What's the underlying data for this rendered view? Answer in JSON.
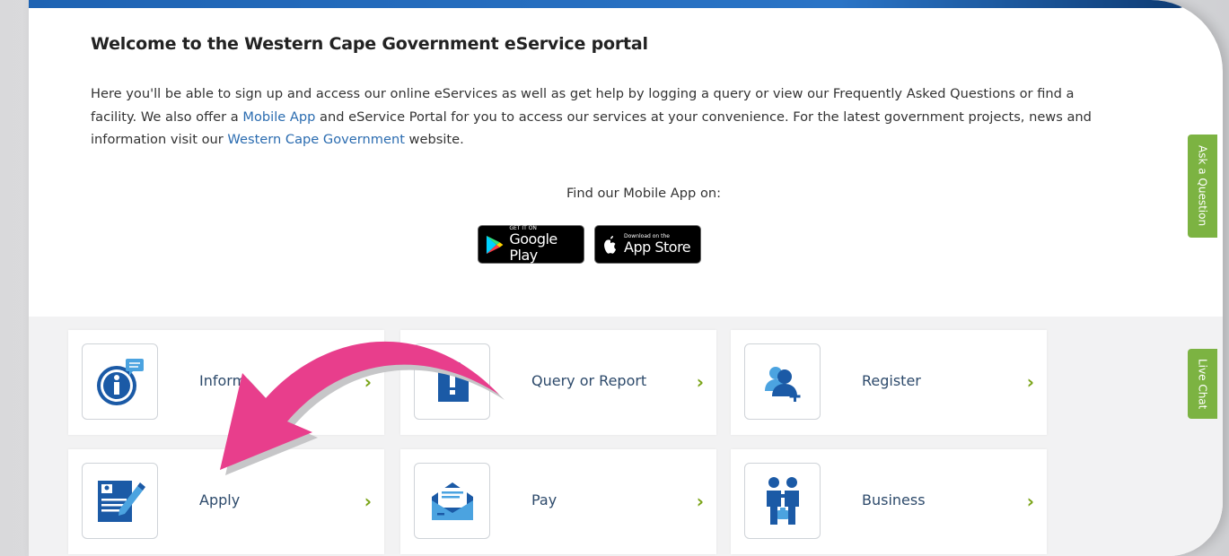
{
  "welcome": {
    "title": "Welcome to the Western Cape Government eService portal",
    "p1": "Here you'll be able to sign up and access our online eServices as well as get help by logging a query or view our Frequently Asked Questions or find a facility. We also offer a ",
    "link_mobile": "Mobile App",
    "p2": " and eService Portal for you to access our services at your convenience. For the latest government projects, news and information visit our ",
    "link_wcg": "Western Cape Government",
    "p3": " website."
  },
  "mobile": {
    "find_label": "Find our Mobile App on:",
    "google": {
      "small": "GET IT ON",
      "big": "Google Play"
    },
    "apple": {
      "small": "Download on the",
      "big": "App Store"
    }
  },
  "services": [
    {
      "label": "Inform",
      "icon": "info-icon"
    },
    {
      "label": "Query or Report",
      "icon": "document-icon"
    },
    {
      "label": "Register",
      "icon": "register-user-icon"
    },
    {
      "label": "Apply",
      "icon": "application-form-icon"
    },
    {
      "label": "Pay",
      "icon": "envelope-pay-icon"
    },
    {
      "label": "Business",
      "icon": "business-people-icon"
    }
  ],
  "chevron": "›",
  "side_tabs": {
    "ask": "Ask a Question",
    "chat": "Live Chat"
  },
  "colors": {
    "accent_green": "#7cb342",
    "arrow_pink": "#e83e8c",
    "link_blue": "#2b6cb0",
    "icon_blue": "#1b5aa6"
  }
}
